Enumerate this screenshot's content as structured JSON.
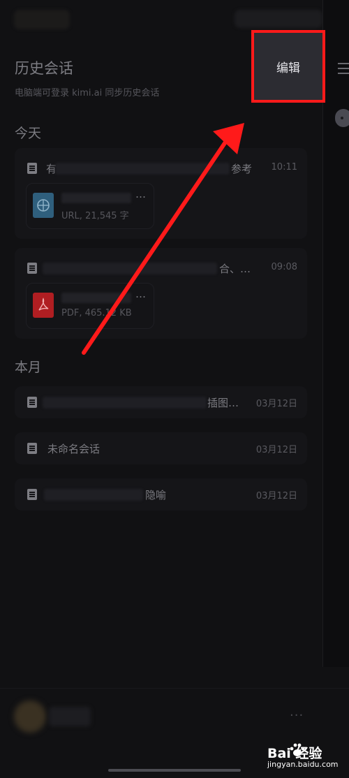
{
  "header": {
    "title": "历史会话",
    "subtitle": "电脑端可登录 kimi.ai 同步历史会话",
    "edit_label": "编辑"
  },
  "sections": [
    {
      "title": "今天",
      "items": [
        {
          "title_prefix": "有",
          "title_suffix": "参考",
          "time": "10:11",
          "attachment": {
            "type": "url",
            "ellipsis": "…",
            "meta": "URL, 21,545 字"
          }
        },
        {
          "title_prefix": "",
          "title_suffix": "合、…",
          "time": "09:08",
          "attachment": {
            "type": "pdf",
            "ellipsis": "…",
            "meta": "PDF, 465.12 KB"
          }
        }
      ]
    },
    {
      "title": "本月",
      "items": [
        {
          "title_prefix": "",
          "title_suffix": "插图…",
          "time": "03月12日"
        },
        {
          "title_prefix": "未命名会话",
          "title_suffix": "",
          "time": "03月12日"
        },
        {
          "title_prefix": "",
          "title_suffix": "隐喻",
          "time": "03月12日"
        }
      ]
    }
  ],
  "footer": {
    "more": "···"
  },
  "watermark": {
    "brand": "Bai  经验",
    "url": "jingyan.baidu.com"
  },
  "colors": {
    "highlight": "#ff1a1a",
    "url_icon": "#2f5f7d",
    "pdf_icon": "#b01e22"
  }
}
